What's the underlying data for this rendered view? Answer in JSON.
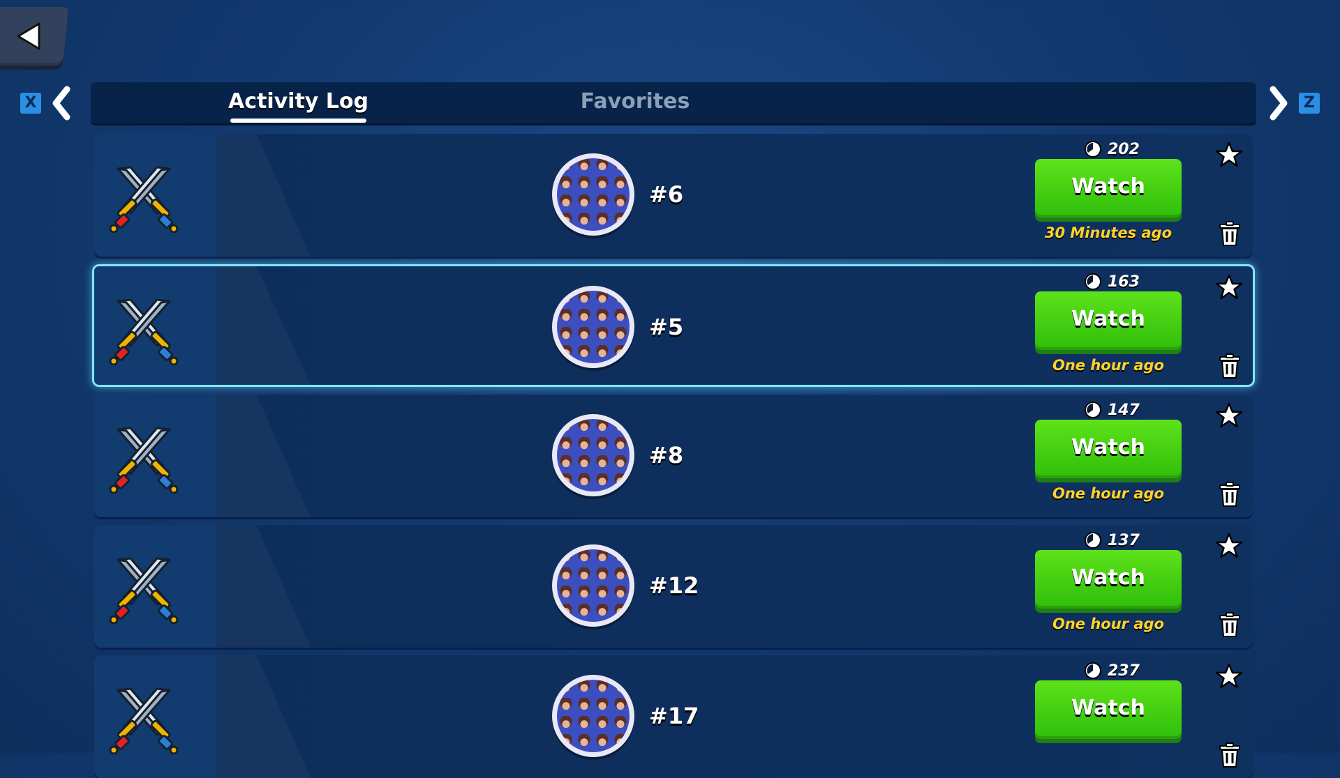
{
  "nav": {
    "key_left": "X",
    "key_right": "Z"
  },
  "tabs": [
    {
      "label": "Activity Log",
      "active": true
    },
    {
      "label": "Favorites",
      "active": false
    }
  ],
  "colors": {
    "watch_button": "#3fcf0f",
    "time_text": "#ffd22a",
    "selected_border": "#7fe8ff",
    "key_hint": "#2b8fe6"
  },
  "rows": [
    {
      "rank": "#6",
      "trophies": "202",
      "button": "Watch",
      "time": "30 Minutes ago",
      "selected": false
    },
    {
      "rank": "#5",
      "trophies": "163",
      "button": "Watch",
      "time": "One hour ago",
      "selected": true
    },
    {
      "rank": "#8",
      "trophies": "147",
      "button": "Watch",
      "time": "One hour ago",
      "selected": false
    },
    {
      "rank": "#12",
      "trophies": "137",
      "button": "Watch",
      "time": "One hour ago",
      "selected": false
    },
    {
      "rank": "#17",
      "trophies": "237",
      "button": "Watch",
      "time": "",
      "selected": false
    }
  ]
}
